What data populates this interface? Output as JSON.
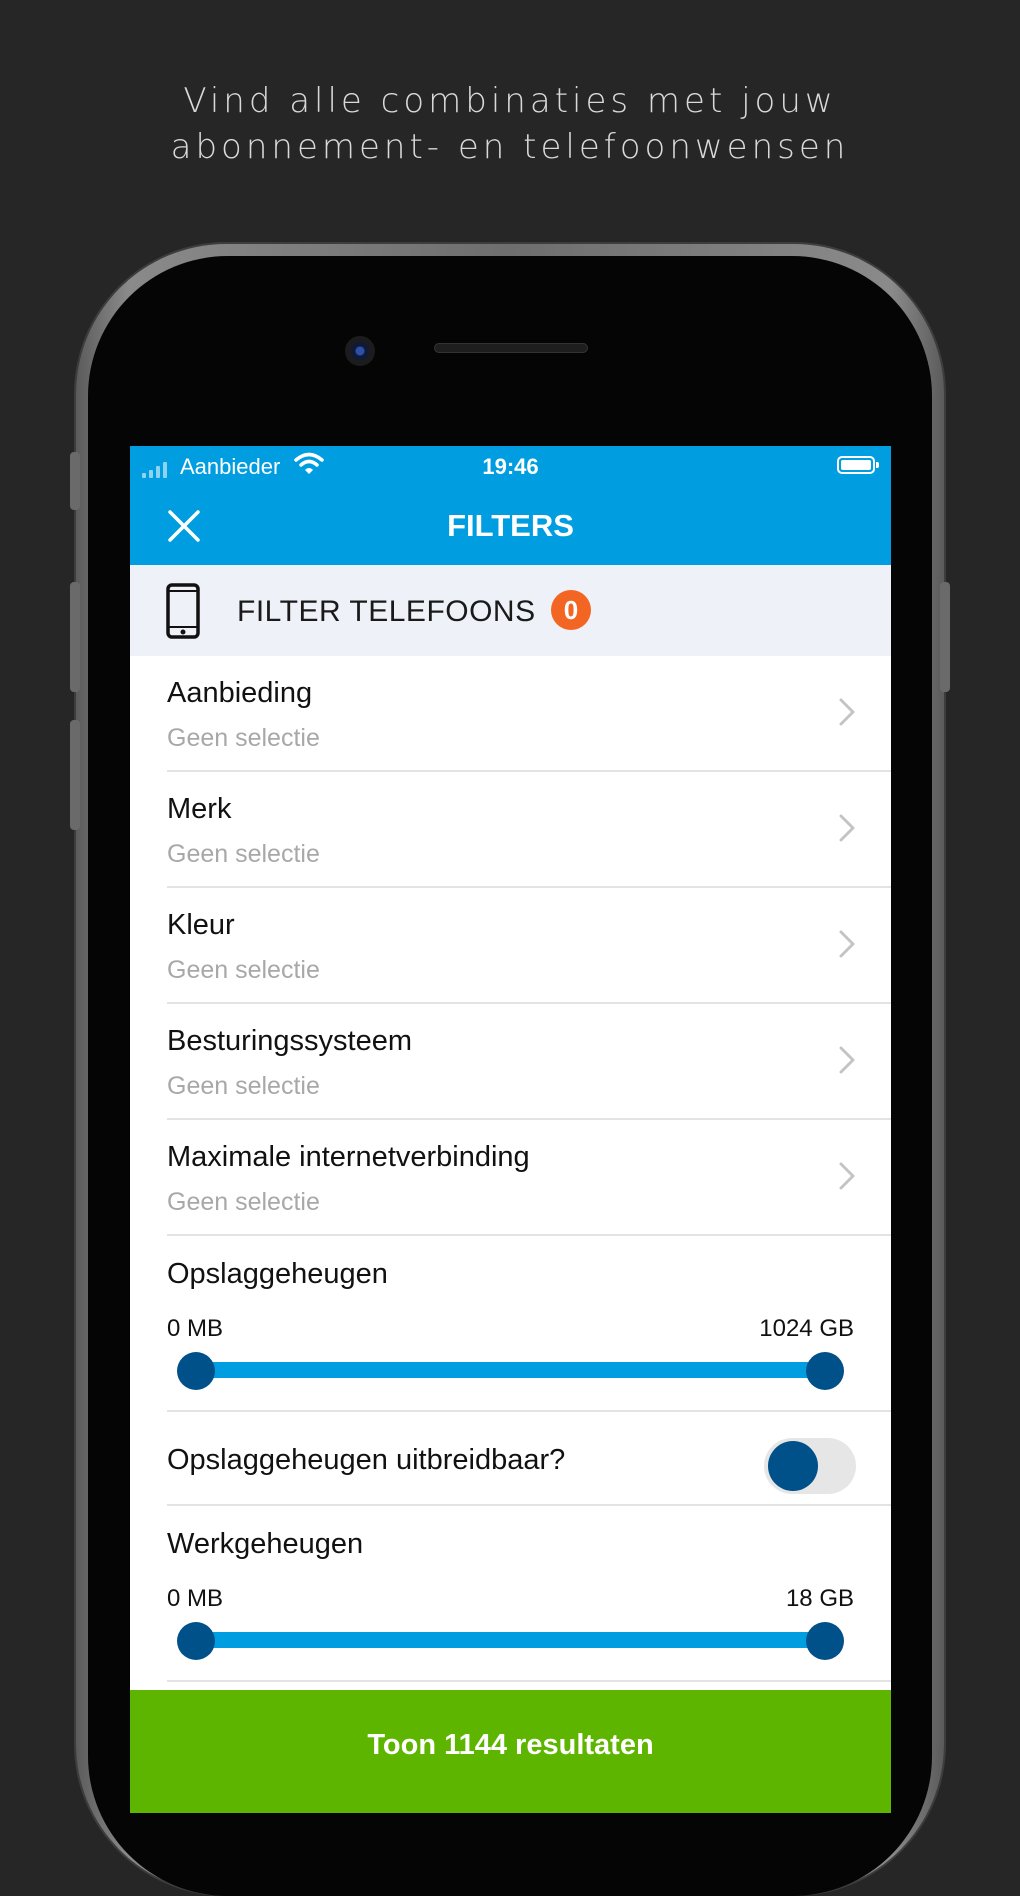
{
  "promo": {
    "line1": "Vind alle combinaties met jouw",
    "line2": "abonnement- en telefoonwensen"
  },
  "status": {
    "carrier": "Aanbieder",
    "time": "19:46"
  },
  "nav": {
    "title": "FILTERS",
    "close_icon": "close-icon"
  },
  "filter_header": {
    "title": "FILTER TELEFOONS",
    "count": "0",
    "icon": "smartphone-icon",
    "badge_color": "#f26522"
  },
  "rows": [
    {
      "title": "Aanbieding",
      "value": "Geen selectie"
    },
    {
      "title": "Merk",
      "value": "Geen selectie"
    },
    {
      "title": "Kleur",
      "value": "Geen selectie"
    },
    {
      "title": "Besturingssysteem",
      "value": "Geen selectie"
    },
    {
      "title": "Maximale internetverbinding",
      "value": "Geen selectie"
    }
  ],
  "storage": {
    "title": "Opslaggeheugen",
    "min": "0 MB",
    "max": "1024 GB"
  },
  "expandable": {
    "label": "Opslaggeheugen uitbreidbaar?",
    "enabled": false
  },
  "memory": {
    "title": "Werkgeheugen",
    "min": "0 MB",
    "max": "18 GB"
  },
  "cta": {
    "label": "Toon 1144 resultaten"
  },
  "colors": {
    "brand_blue": "#009ee0",
    "thumb_navy": "#005089",
    "cta_green": "#5eb500",
    "header_bg": "#eef1f7"
  }
}
